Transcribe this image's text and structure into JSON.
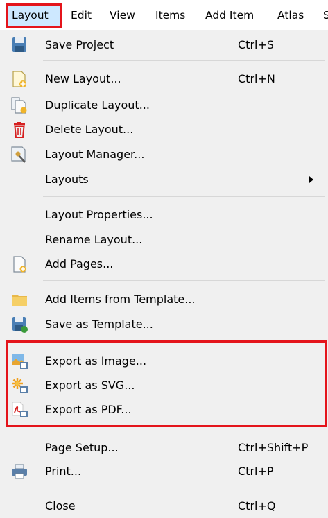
{
  "menubar": {
    "items": [
      "Layout",
      "Edit",
      "View",
      "Items",
      "Add Item",
      "Atlas",
      "S"
    ]
  },
  "menu": {
    "save_project": {
      "label": "Save Project",
      "shortcut": "Ctrl+S"
    },
    "new_layout": {
      "label": "New Layout...",
      "shortcut": "Ctrl+N"
    },
    "duplicate_layout": {
      "label": "Duplicate Layout..."
    },
    "delete_layout": {
      "label": "Delete Layout..."
    },
    "layout_manager": {
      "label": "Layout Manager..."
    },
    "layouts": {
      "label": "Layouts"
    },
    "layout_properties": {
      "label": "Layout Properties..."
    },
    "rename_layout": {
      "label": "Rename Layout..."
    },
    "add_pages": {
      "label": "Add Pages..."
    },
    "add_items_template": {
      "label": "Add Items from Template..."
    },
    "save_as_template": {
      "label": "Save as Template..."
    },
    "export_image": {
      "label": "Export as Image..."
    },
    "export_svg": {
      "label": "Export as SVG..."
    },
    "export_pdf": {
      "label": "Export as PDF..."
    },
    "page_setup": {
      "label": "Page Setup...",
      "shortcut": "Ctrl+Shift+P"
    },
    "print": {
      "label": "Print...",
      "shortcut": "Ctrl+P"
    },
    "close": {
      "label": "Close",
      "shortcut": "Ctrl+Q"
    }
  },
  "colors": {
    "highlight_box": "#e4141b",
    "menubar_active": "#cde8ff",
    "menu_background": "#f0f0f0"
  },
  "icons": {
    "save_project": "floppy-disk-icon",
    "new_layout": "new-layout-icon",
    "duplicate_layout": "duplicate-layout-icon",
    "delete_layout": "trash-icon",
    "layout_manager": "layout-manager-icon",
    "add_pages": "add-pages-icon",
    "add_items_template": "folder-icon",
    "save_as_template": "save-template-icon",
    "export_image": "export-image-icon",
    "export_svg": "export-svg-icon",
    "export_pdf": "export-pdf-icon",
    "print": "printer-icon"
  }
}
